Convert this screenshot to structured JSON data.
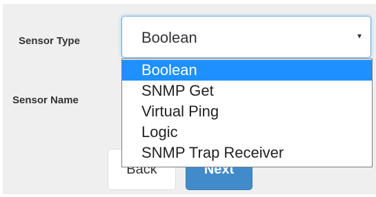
{
  "form": {
    "sensor_type_label": "Sensor Type",
    "sensor_name_label": "Sensor Name",
    "sensor_type_select": {
      "value": "Boolean",
      "caret": "▾"
    },
    "buttons": {
      "back_label": "Back",
      "next_label": "Next"
    }
  },
  "dropdown": {
    "options": [
      {
        "label": "Boolean",
        "selected": true
      },
      {
        "label": "SNMP Get",
        "selected": false
      },
      {
        "label": "Virtual Ping",
        "selected": false
      },
      {
        "label": "Logic",
        "selected": false
      },
      {
        "label": "SNMP Trap Receiver",
        "selected": false
      }
    ]
  },
  "colors": {
    "highlight": "#1e90ff",
    "primary_button": "#428bca",
    "panel_background": "#efefef",
    "focus_border": "#6fa6dd"
  }
}
